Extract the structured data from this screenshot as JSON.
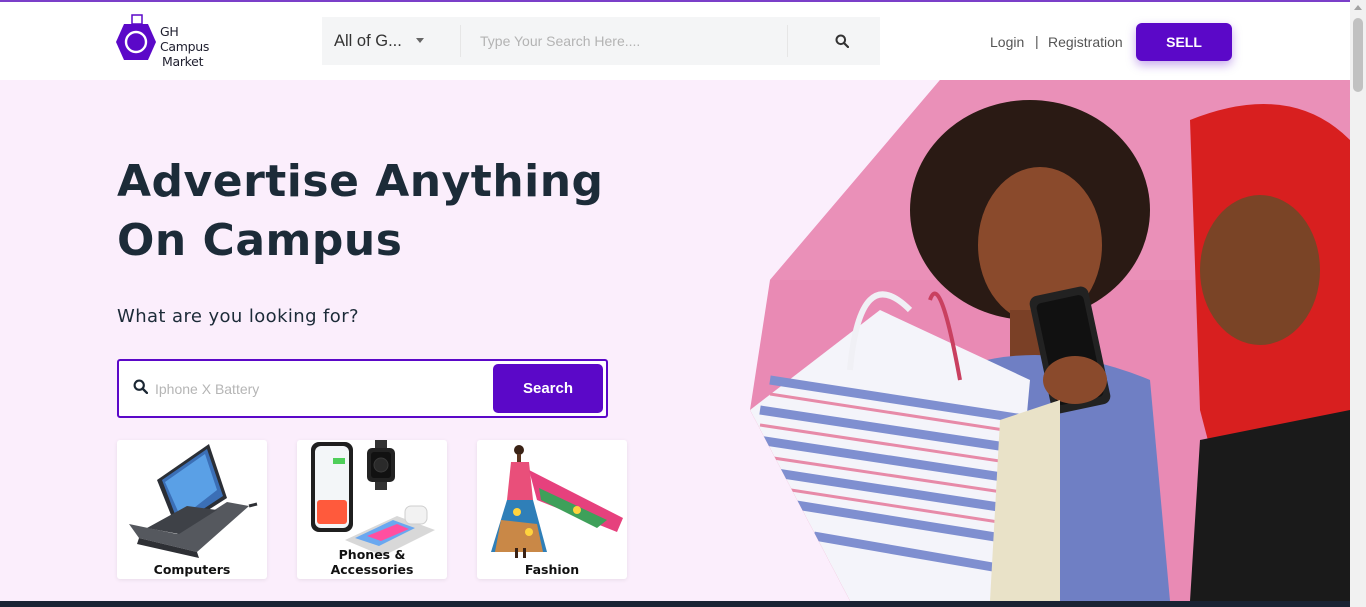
{
  "brand": {
    "logo_line1": "GH",
    "logo_line2": "Campus",
    "logo_line3": "Market",
    "accent_color": "#5b08c8"
  },
  "header": {
    "category_selected": "All of G...",
    "search_placeholder": "Type Your Search Here....",
    "login_label": "Login",
    "separator": "|",
    "registration_label": "Registration",
    "sell_label": "SELL"
  },
  "hero": {
    "title_line1": "Advertise Anything",
    "title_line2": "On Campus",
    "subtitle": "What are you looking for?",
    "search_placeholder": "Iphone X Battery",
    "search_button": "Search",
    "background_color": "#fbeefc"
  },
  "categories": [
    {
      "label": "Computers",
      "icon": "laptop-icon"
    },
    {
      "label": "Phones & Accessories",
      "icon": "phone-icon"
    },
    {
      "label": "Fashion",
      "icon": "dress-icon"
    }
  ]
}
